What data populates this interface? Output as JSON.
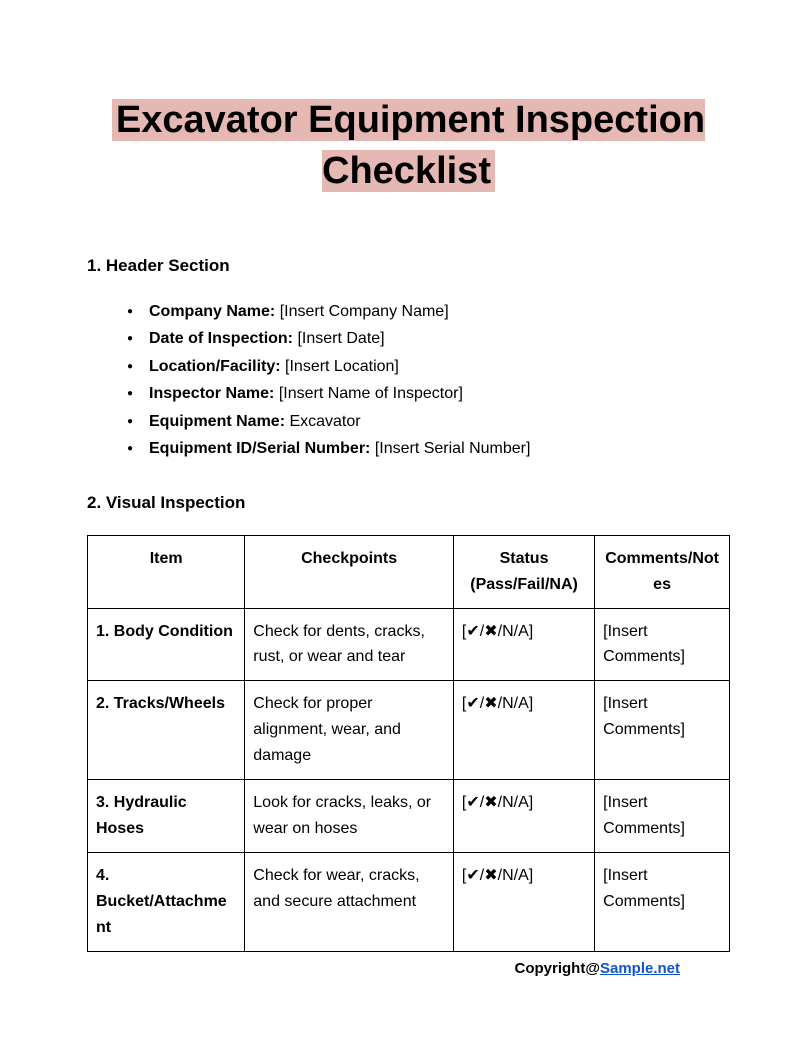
{
  "title": "Excavator Equipment Inspection Checklist",
  "section1": {
    "heading": "1. Header Section",
    "items": [
      {
        "label": "Company Name:",
        "value": " [Insert Company Name]"
      },
      {
        "label": "Date of Inspection:",
        "value": " [Insert Date]"
      },
      {
        "label": "Location/Facility:",
        "value": " [Insert Location]"
      },
      {
        "label": "Inspector Name:",
        "value": " [Insert Name of Inspector]"
      },
      {
        "label": "Equipment Name:",
        "value": " Excavator"
      },
      {
        "label": "Equipment ID/Serial Number:",
        "value": " [Insert Serial Number]"
      }
    ]
  },
  "section2": {
    "heading": "2. Visual Inspection",
    "headers": [
      "Item",
      "Checkpoints",
      "Status (Pass/Fail/NA)",
      "Comments/Notes"
    ],
    "rows": [
      {
        "item": "1. Body Condition",
        "checkpoint": "Check for dents, cracks, rust, or wear and tear",
        "status": "[✔/✖/N/A]",
        "comments": "[Insert Comments]"
      },
      {
        "item": "2. Tracks/Wheels",
        "checkpoint": "Check for proper alignment, wear, and damage",
        "status": "[✔/✖/N/A]",
        "comments": "[Insert Comments]"
      },
      {
        "item": "3. Hydraulic Hoses",
        "checkpoint": "Look for cracks, leaks, or wear on hoses",
        "status": "[✔/✖/N/A]",
        "comments": "[Insert Comments]"
      },
      {
        "item": "4. Bucket/Attachment",
        "checkpoint": "Check for wear, cracks, and secure attachment",
        "status": "[✔/✖/N/A]",
        "comments": "[Insert Comments]"
      }
    ]
  },
  "footer": {
    "prefix": "Copyright@",
    "link_text": "Sample.net"
  }
}
